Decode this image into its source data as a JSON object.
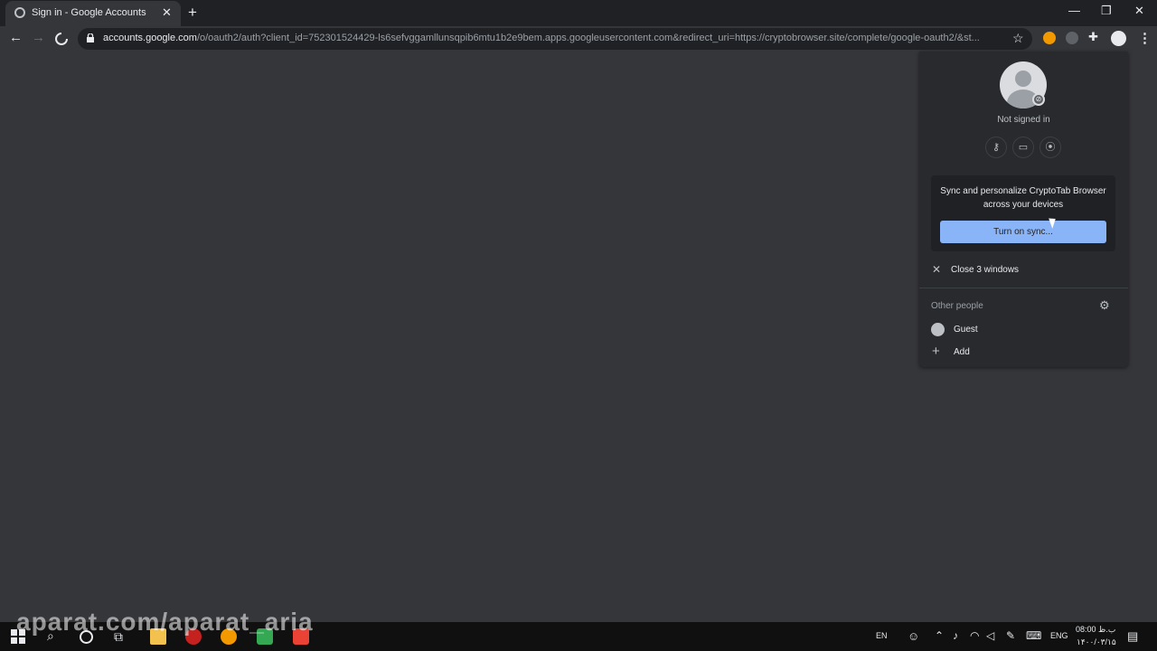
{
  "tab": {
    "title": "Sign in - Google Accounts",
    "close": "✕"
  },
  "window": {
    "minimize": "—",
    "restore": "❐",
    "close": "✕"
  },
  "toolbar": {
    "back": "←",
    "forward": "→",
    "url_host": "accounts.google.com",
    "url_path": "/o/oauth2/auth?client_id=752301524429-ls6sefvggamllunsqpib6mtu1b2e9bem.apps.googleusercontent.com&redirect_uri=https://cryptobrowser.site/complete/google-oauth2/&st..."
  },
  "profile_menu": {
    "status": "Not signed in",
    "sync_text": "Sync and personalize CryptoTab Browser across your devices",
    "sync_button": "Turn on sync...",
    "close_windows": "Close 3 windows",
    "other_people_label": "Other people",
    "people": [
      {
        "label": "Guest"
      },
      {
        "label": "Add"
      }
    ]
  },
  "taskbar": {
    "lang_short": "EN",
    "lang": "ENG",
    "time": "08:00 ب.ظ",
    "date": "۱۴۰۰/۰۳/۱۵"
  },
  "watermark": "aparat.com/aparat_aria",
  "colors": {
    "accent": "#8ab4f8",
    "menu_bg": "#292a2d",
    "frame": "#202124"
  }
}
